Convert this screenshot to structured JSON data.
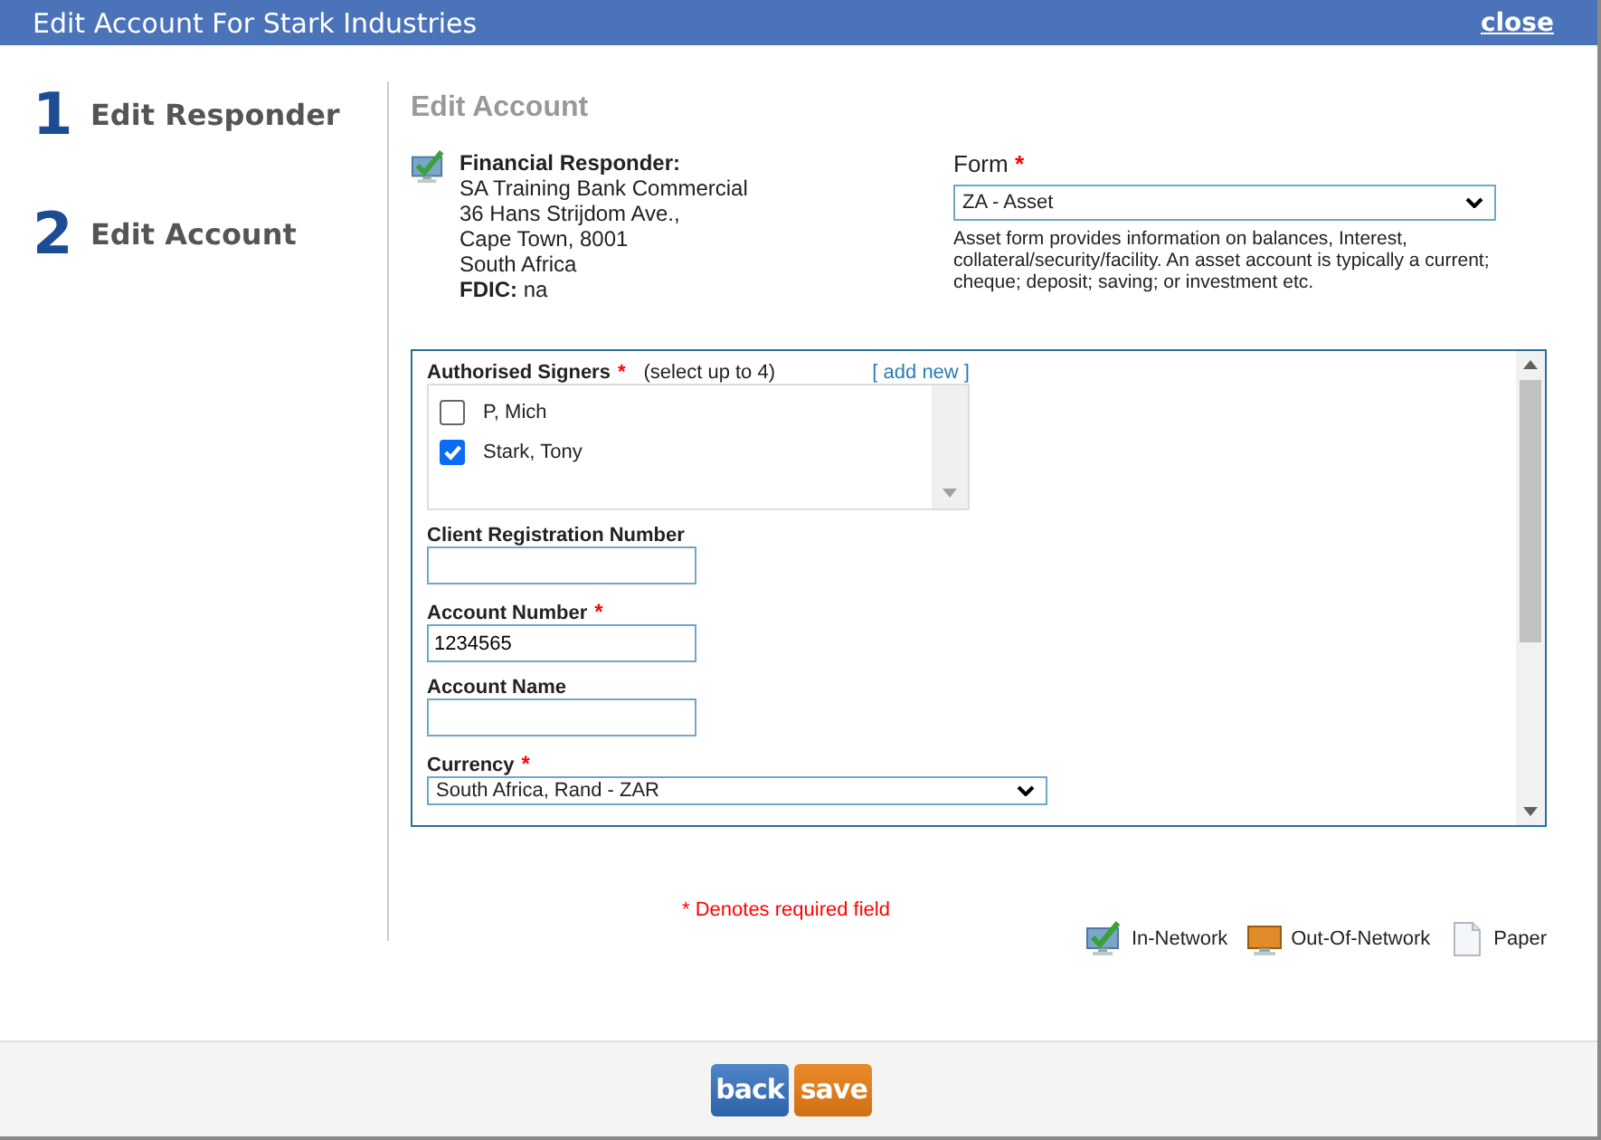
{
  "window": {
    "title": "Edit Account For Stark Industries",
    "close": "close"
  },
  "required_mark": "*",
  "steps": [
    {
      "number": "1",
      "label": "Edit Responder"
    },
    {
      "number": "2",
      "label": "Edit Account"
    }
  ],
  "section_title": "Edit Account",
  "responder": {
    "heading": "Financial Responder:",
    "lines": [
      "SA Training Bank Commercial",
      "36 Hans Strijdom Ave.,",
      "Cape Town, 8001",
      "South Africa"
    ],
    "fdic_label": "FDIC:",
    "fdic_value": "na"
  },
  "form": {
    "label": "Form",
    "required": true,
    "value": "ZA - Asset",
    "description": "Asset form provides information on balances, Interest, collateral/security/facility. An asset account is typically a current; cheque; deposit; saving; or investment etc."
  },
  "signers": {
    "label": "Authorised Signers",
    "required": true,
    "hint": "(select up to 4)",
    "add_link": "[ add new ]",
    "items": [
      {
        "name": "P, Mich",
        "checked": false
      },
      {
        "name": "Stark, Tony",
        "checked": true
      }
    ]
  },
  "fields": [
    {
      "kind": "text",
      "label": "Client Registration Number",
      "required": false
    },
    {
      "kind": "text",
      "label": "Account Number",
      "required": true,
      "value": "1234565"
    },
    {
      "kind": "text",
      "label": "Account Name",
      "required": false
    },
    {
      "kind": "select",
      "label": "Currency",
      "required": true,
      "value": "South Africa, Rand - ZAR"
    }
  ],
  "required_note": "* Denotes required field",
  "legend": [
    {
      "kind": "in-network",
      "label": "In-Network"
    },
    {
      "kind": "out-of-network",
      "label": "Out-Of-Network"
    },
    {
      "kind": "paper",
      "label": "Paper"
    }
  ],
  "buttons": [
    {
      "kind": "back",
      "label": "back"
    },
    {
      "kind": "save",
      "label": "save"
    }
  ]
}
